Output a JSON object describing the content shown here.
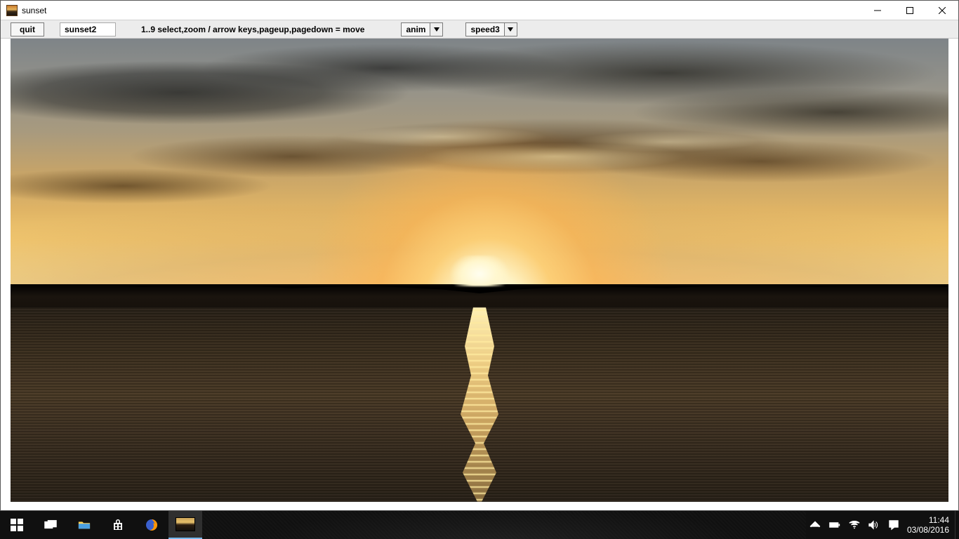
{
  "window": {
    "title": "sunset"
  },
  "toolbar": {
    "quit_label": "quit",
    "filename": "sunset2",
    "hint": "1..9 select,zoom / arrow keys,pageup,pagedown = move",
    "anim_select": "anim",
    "speed_select": "speed3"
  },
  "taskbar": {
    "time": "11:44",
    "date": "03/08/2016"
  }
}
